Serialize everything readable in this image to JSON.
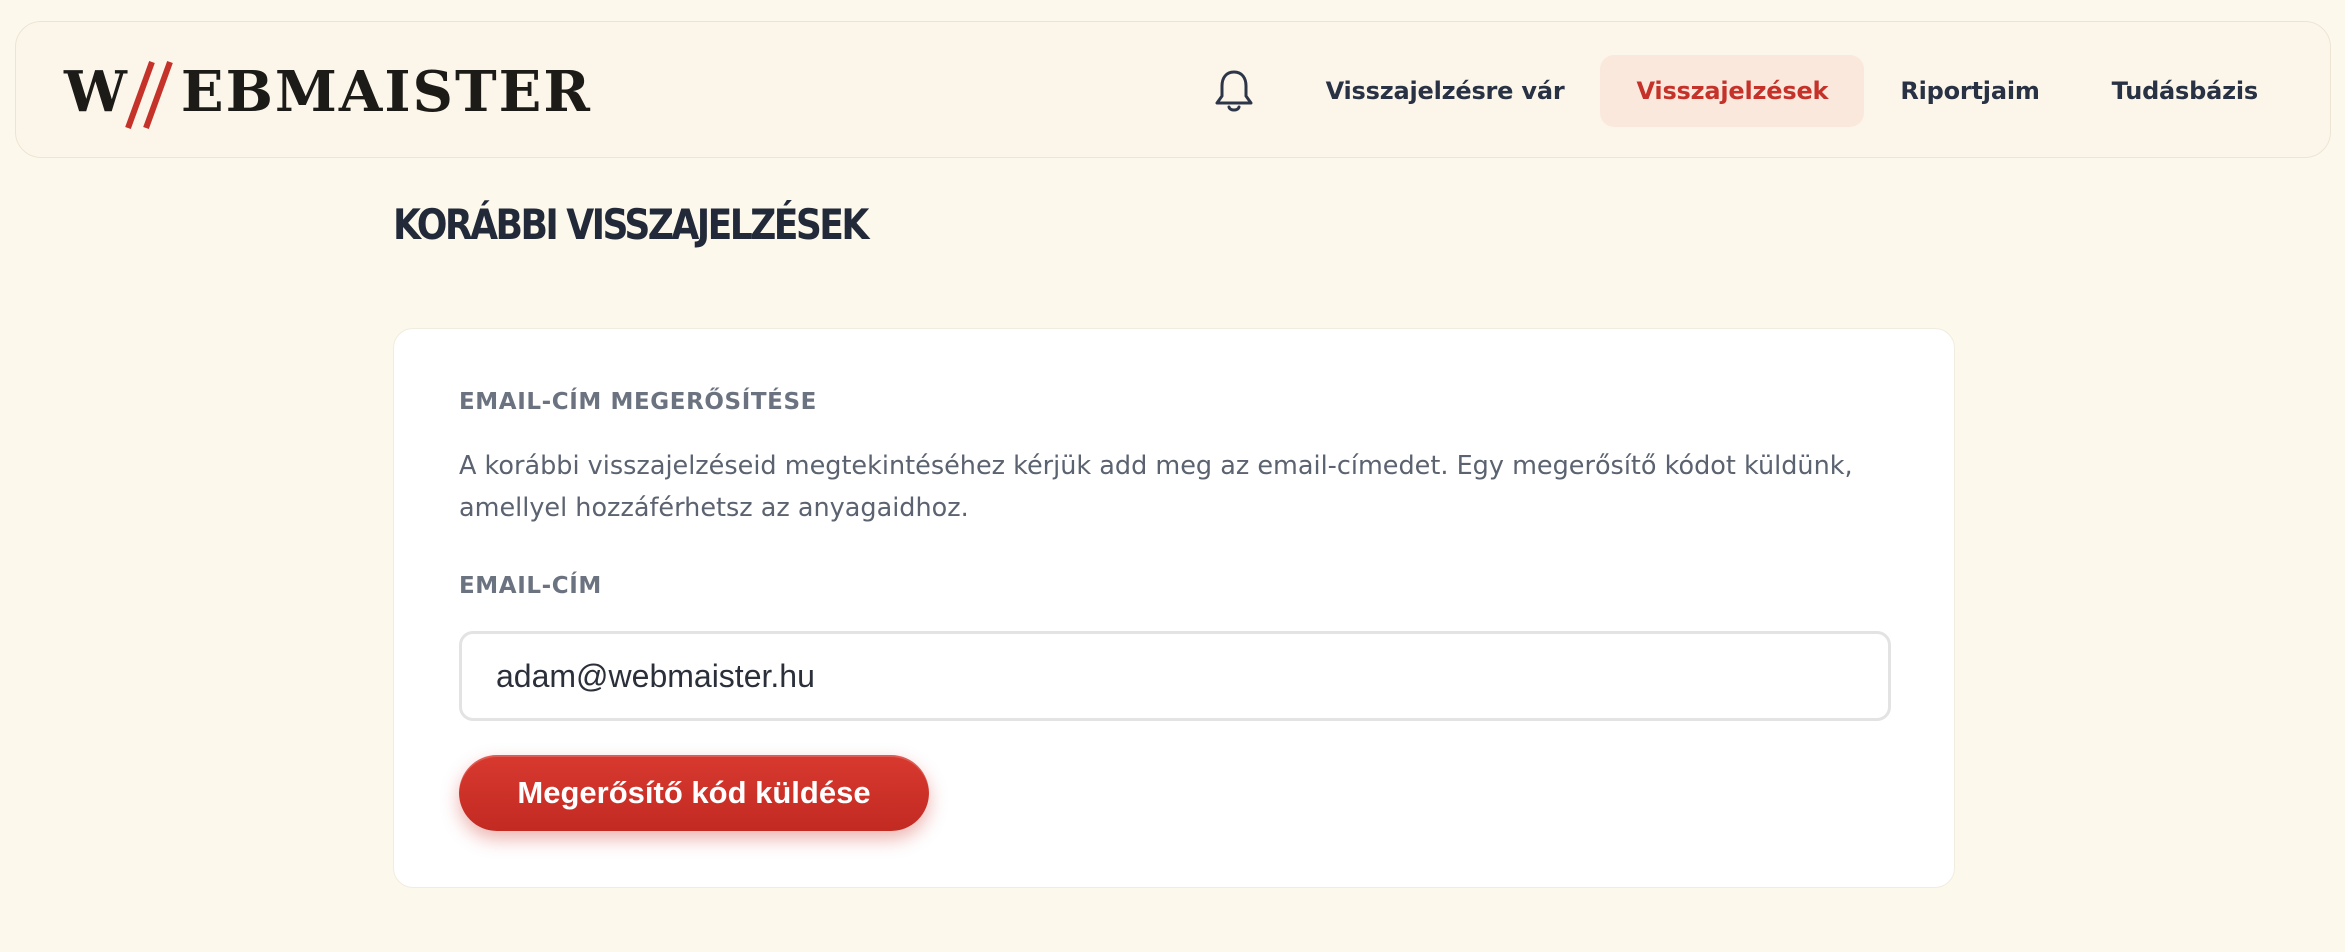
{
  "header": {
    "logo": {
      "letter_first": "W",
      "letter_rest": "EBMAISTER",
      "text": "WEBMAISTER"
    },
    "bell_icon": "bell-icon",
    "nav": [
      {
        "label": "Visszajelzésre vár",
        "active": false
      },
      {
        "label": "Visszajelzések",
        "active": true
      },
      {
        "label": "Riportjaim",
        "active": false
      },
      {
        "label": "Tudásbázis",
        "active": false
      }
    ]
  },
  "page": {
    "title": "Korábbi visszajelzések"
  },
  "card": {
    "section_label": "EMAIL-CÍM MEGERŐSÍTÉSE",
    "description_line1": "A korábbi visszajelzéseid megtekintéséhez kérjük add meg az email-címedet. Egy megerősítő kódot küldünk,",
    "description_line2": "amellyel hozzáférhetsz az anyagaidhoz.",
    "email_label": "EMAIL-CÍM",
    "email_value": "adam@webmaister.hu",
    "submit_label": "Megerősítő kód küldése"
  },
  "colors": {
    "background": "#fdf8ec",
    "accent": "#c4322a",
    "active_nav_bg": "#fbe8dc",
    "text_dark": "#222a3a",
    "text_muted": "#6b7280"
  }
}
